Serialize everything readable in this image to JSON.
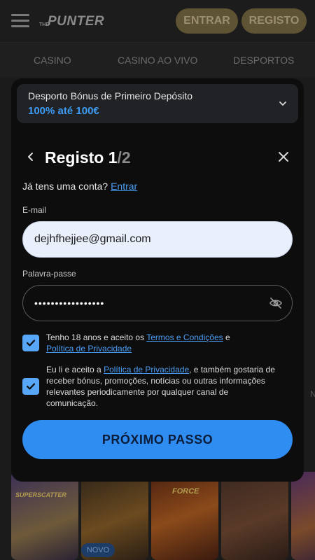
{
  "header": {
    "logo_prefix": "THE",
    "logo_text": "PUNTER",
    "login_label": "ENTRAR",
    "register_label": "REGISTO"
  },
  "nav": {
    "tabs": [
      {
        "label": "CASINO"
      },
      {
        "label": "CASINO AO VIVO"
      },
      {
        "label": "DESPORTOS"
      }
    ]
  },
  "background": {
    "side_label": "N",
    "game_tile_title": "SUPERSCATTER",
    "game_tile_3_title": "FORCE",
    "new_badge": "NOVO"
  },
  "promo": {
    "title": "Desporto Bónus de Primeiro Depósito",
    "value": "100% até 100€"
  },
  "modal": {
    "title": "Registo 1",
    "step_suffix": "/2",
    "have_account_text": "Já tens uma conta?",
    "login_link": "Entrar",
    "email_label": "E-mail",
    "email_value": "dejhfhejjee@gmail.com",
    "password_label": "Palavra-passe",
    "password_value": "•••••••••••••••••",
    "terms": {
      "prefix": "Tenho 18 anos e aceito os ",
      "terms_link": "Termos e Condições",
      "middle": " e",
      "privacy_link": "Política de Privacidade",
      "checked": true
    },
    "marketing": {
      "prefix": "Eu li e aceito a ",
      "privacy_link": "Política de Privacidade",
      "suffix": ", e também gostaria de receber bónus, promoções, notícias ou outras informações relevantes periodicamente por qualquer canal de comunicação.",
      "checked": true
    },
    "next_label": "PRÓXIMO PASSO"
  },
  "colors": {
    "accent": "#2f8cf0",
    "link": "#4a9ef5",
    "header_button": "#5e5332"
  },
  "icons": {
    "menu": "hamburger-icon",
    "promo_toggle": "chevron-down-icon",
    "back": "chevron-left-icon",
    "close": "close-icon",
    "password_visibility": "eye-off-icon",
    "checkbox": "checkmark-icon"
  }
}
